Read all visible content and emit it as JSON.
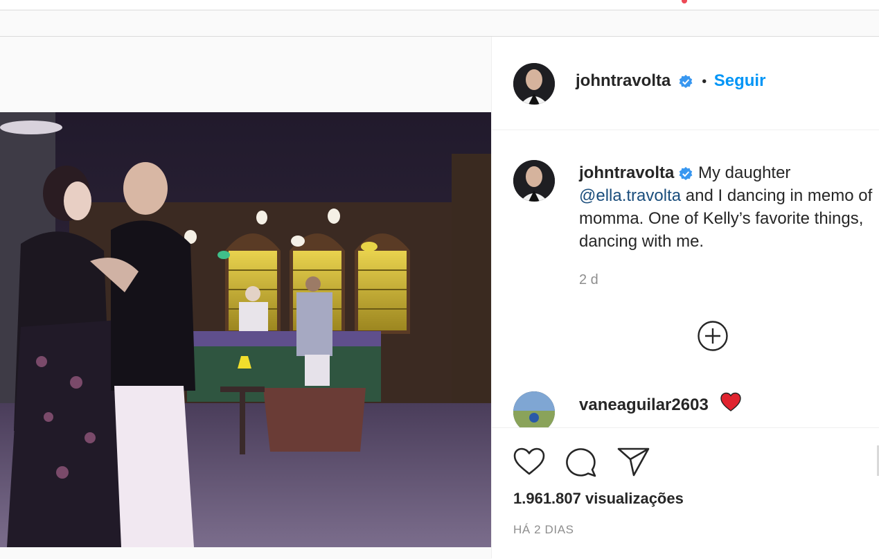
{
  "post": {
    "author": "johntravolta",
    "follow_label": "Seguir",
    "separator": "•",
    "caption_pre": "My daughter",
    "mention": "@ella.travolta",
    "caption_post": "and I dancing in memo of momma. One of Kelly’s favorite things, dancing with me.",
    "caption_age": "2 d",
    "views": "1.961.807 visualizações",
    "posted_when": "HÁ 2 DIAS"
  },
  "comments": [
    {
      "username": "vaneaguilar2603",
      "emoji_icon": "red-heart-icon"
    }
  ],
  "icons": {
    "verified": "verified-badge-icon",
    "load_more": "plus-circle-icon",
    "like": "heart-icon",
    "comment": "comment-bubble-icon",
    "share": "paper-plane-icon"
  },
  "colors": {
    "accent": "#0095f6",
    "mention": "#00376b",
    "secondary_text": "#8e8e8e",
    "notification": "#ed4956"
  }
}
